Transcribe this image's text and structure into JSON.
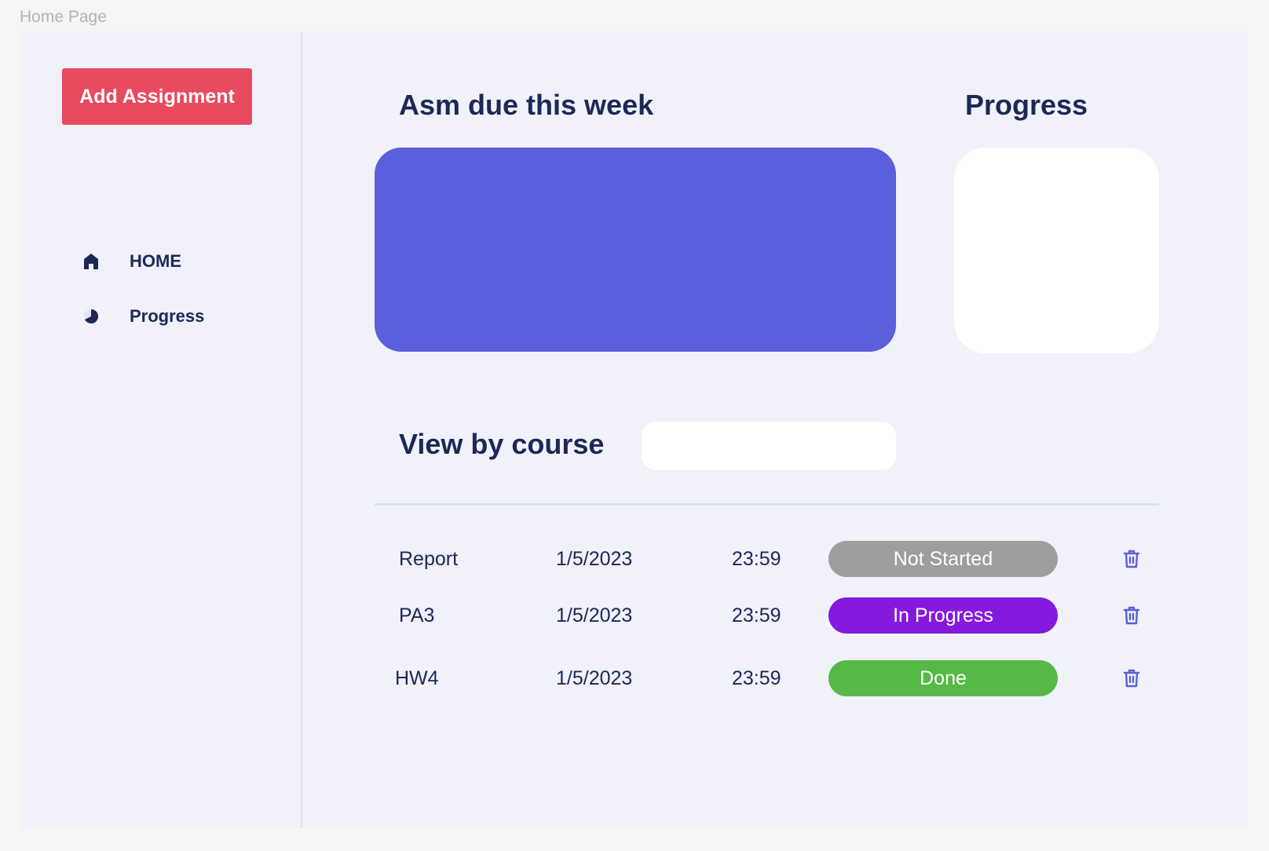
{
  "frame": {
    "label": "Home Page"
  },
  "sidebar": {
    "add_button": "Add Assignment",
    "nav": [
      {
        "label": "HOME",
        "icon": "home-icon"
      },
      {
        "label": "Progress",
        "icon": "pie-chart-icon"
      }
    ]
  },
  "main": {
    "due_title": "Asm due this week",
    "progress_title": "Progress",
    "course_title": "View by course",
    "course_select_value": ""
  },
  "assignments": [
    {
      "name": "Report",
      "date": "1/5/2023",
      "time": "23:59",
      "status": "Not Started",
      "status_color": "#9e9e9e"
    },
    {
      "name": "PA3",
      "date": "1/5/2023",
      "time": "23:59",
      "status": "In Progress",
      "status_color": "#8619de"
    },
    {
      "name": "HW4",
      "date": "1/5/2023",
      "time": "23:59",
      "status": "Done",
      "status_color": "#56b946"
    }
  ],
  "colors": {
    "accent": "#5b5fdb",
    "add_button": "#e84a5f",
    "text_dark": "#1c2856"
  }
}
